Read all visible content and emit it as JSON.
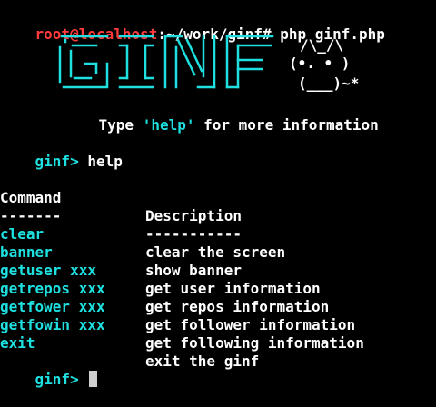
{
  "prompt": {
    "user_host": "root@localhost",
    "path": ":~/work/ginf#",
    "command": "php ginf.php"
  },
  "banner": {
    "logo_text": "GINF",
    "cat_line1": "/\\_/\\",
    "cat_line2": "(•. • )",
    "cat_line3": "(___)~*",
    "hint_prefix": "Type ",
    "hint_keyword": "'help'",
    "hint_suffix": " for more information"
  },
  "session": {
    "shell_prompt": "ginf>",
    "entered_command": "help"
  },
  "help_table": {
    "header_command": "Command",
    "header_description": "Description",
    "rule_command": "-------",
    "rule_description": "-----------",
    "rows": [
      {
        "command": "clear",
        "description": "clear the screen"
      },
      {
        "command": "banner",
        "description": "show banner"
      },
      {
        "command": "getuser xxx",
        "description": "get user information"
      },
      {
        "command": "getrepos xxx",
        "description": "get repos information"
      },
      {
        "command": "getfower xxx",
        "description": "get follower information"
      },
      {
        "command": "getfowin xxx",
        "description": "get following information"
      },
      {
        "command": "exit",
        "description": "exit the ginf"
      }
    ]
  },
  "input_line": {
    "shell_prompt": "ginf>",
    "current_value": ""
  },
  "colors": {
    "background": "#000000",
    "prompt_user": "#ff3b3b",
    "accent_cyan": "#1ee0e0",
    "text": "#ffffff"
  }
}
